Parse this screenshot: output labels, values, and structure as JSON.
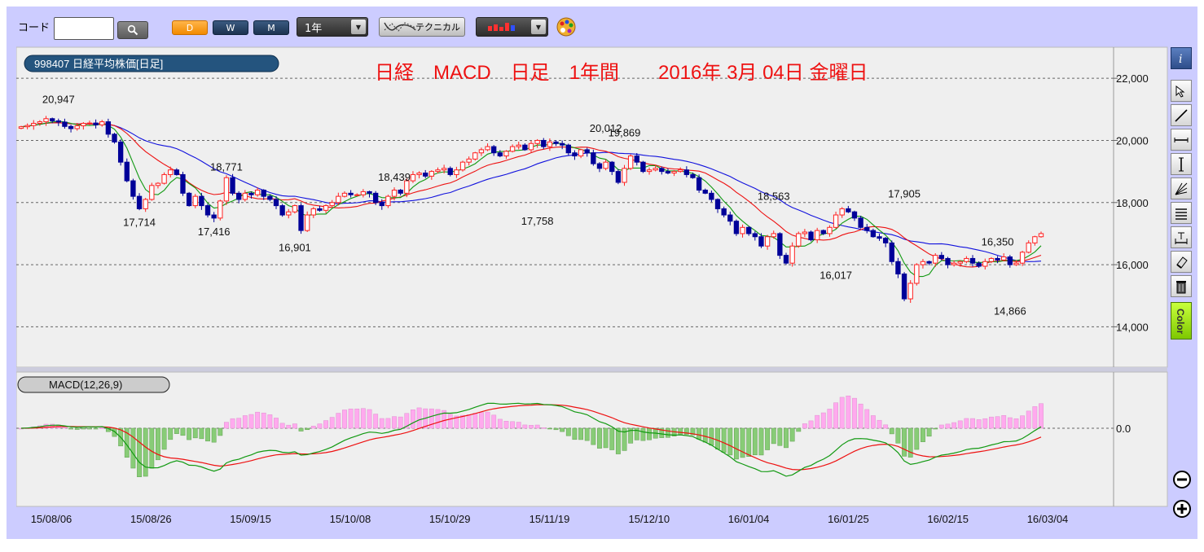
{
  "toolbar": {
    "code_label": "コード",
    "code_value": "",
    "period_buttons": [
      "D",
      "W",
      "M"
    ],
    "period_select": "1年",
    "tech_label": "テクニカル"
  },
  "chart_title_badge": "998407 日経平均株価[日足]",
  "headline": "日経　MACD　日足　1年間　　2016年 3月 04日 金曜日",
  "macd_badge": "MACD(12,26,9)",
  "colors": {
    "up": "#ff2020",
    "down": "#000099",
    "sma_short": "#119911",
    "sma_mid": "#ee1111",
    "sma_long": "#1111dd",
    "hist_pos": "#ffaaee",
    "hist_neg": "#88cc77",
    "headline": "#ee1111"
  },
  "chart_data": [
    {
      "type": "candlestick",
      "title": "998407 日経平均株価[日足]",
      "y_ticks": [
        "22,000",
        "20,000",
        "18,000",
        "16,000",
        "14,000"
      ],
      "ylim": [
        12700,
        23000
      ],
      "x_ticks": [
        "15/08/06",
        "15/08/26",
        "15/09/15",
        "15/10/08",
        "15/10/29",
        "15/11/19",
        "15/12/10",
        "16/01/04",
        "16/01/25",
        "16/02/15",
        "16/03/04"
      ],
      "annotations": [
        {
          "label": "20,947",
          "value": 20947
        },
        {
          "label": "17,714",
          "value": 17714
        },
        {
          "label": "18,771",
          "value": 18771
        },
        {
          "label": "17,416",
          "value": 17416
        },
        {
          "label": "16,901",
          "value": 16901
        },
        {
          "label": "18,439",
          "value": 18439
        },
        {
          "label": "17,758",
          "value": 17758
        },
        {
          "label": "20,012",
          "value": 20012
        },
        {
          "label": "19,869",
          "value": 19869
        },
        {
          "label": "18,563",
          "value": 18563
        },
        {
          "label": "16,017",
          "value": 16017
        },
        {
          "label": "17,905",
          "value": 17905
        },
        {
          "label": "14,866",
          "value": 14866
        },
        {
          "label": "16,350",
          "value": 16350
        }
      ],
      "close": [
        20440,
        20480,
        20550,
        20600,
        20700,
        20630,
        20590,
        20450,
        20380,
        20470,
        20550,
        20560,
        20500,
        20600,
        20200,
        19950,
        19300,
        18700,
        18200,
        17800,
        18100,
        18550,
        18620,
        18900,
        19050,
        18900,
        18300,
        17900,
        18200,
        17900,
        17600,
        17500,
        18050,
        18800,
        18300,
        18100,
        18300,
        18250,
        18400,
        18200,
        18100,
        17900,
        17600,
        17700,
        17900,
        17100,
        17600,
        17800,
        17750,
        17900,
        18000,
        18200,
        18300,
        18250,
        18250,
        18350,
        18300,
        18000,
        17900,
        18200,
        18400,
        18300,
        18700,
        18900,
        18950,
        18850,
        19000,
        19050,
        19100,
        18900,
        19050,
        19300,
        19400,
        19600,
        19700,
        19800,
        19600,
        19500,
        19650,
        19800,
        19850,
        19700,
        19900,
        20000,
        19800,
        19950,
        19900,
        19850,
        19600,
        19500,
        19700,
        19600,
        19250,
        19100,
        19300,
        19000,
        18650,
        19100,
        19500,
        19300,
        19000,
        19050,
        19100,
        19000,
        18950,
        19000,
        19050,
        18900,
        18800,
        18400,
        18300,
        18100,
        17800,
        17600,
        17400,
        17000,
        17200,
        17000,
        16900,
        16600,
        16900,
        17000,
        16300,
        16050,
        16600,
        17000,
        17050,
        16800,
        17100,
        17000,
        17200,
        17600,
        17800,
        17700,
        17500,
        17200,
        17100,
        16900,
        16850,
        16700,
        16100,
        15700,
        14900,
        15400,
        16000,
        16100,
        16050,
        16300,
        16200,
        16000,
        16050,
        16100,
        16200,
        16050,
        15950,
        16100,
        16200,
        16150,
        16250,
        16000,
        16050,
        16400,
        16700,
        16900,
        17000
      ],
      "macd_ticks": [
        "0.0"
      ]
    }
  ]
}
